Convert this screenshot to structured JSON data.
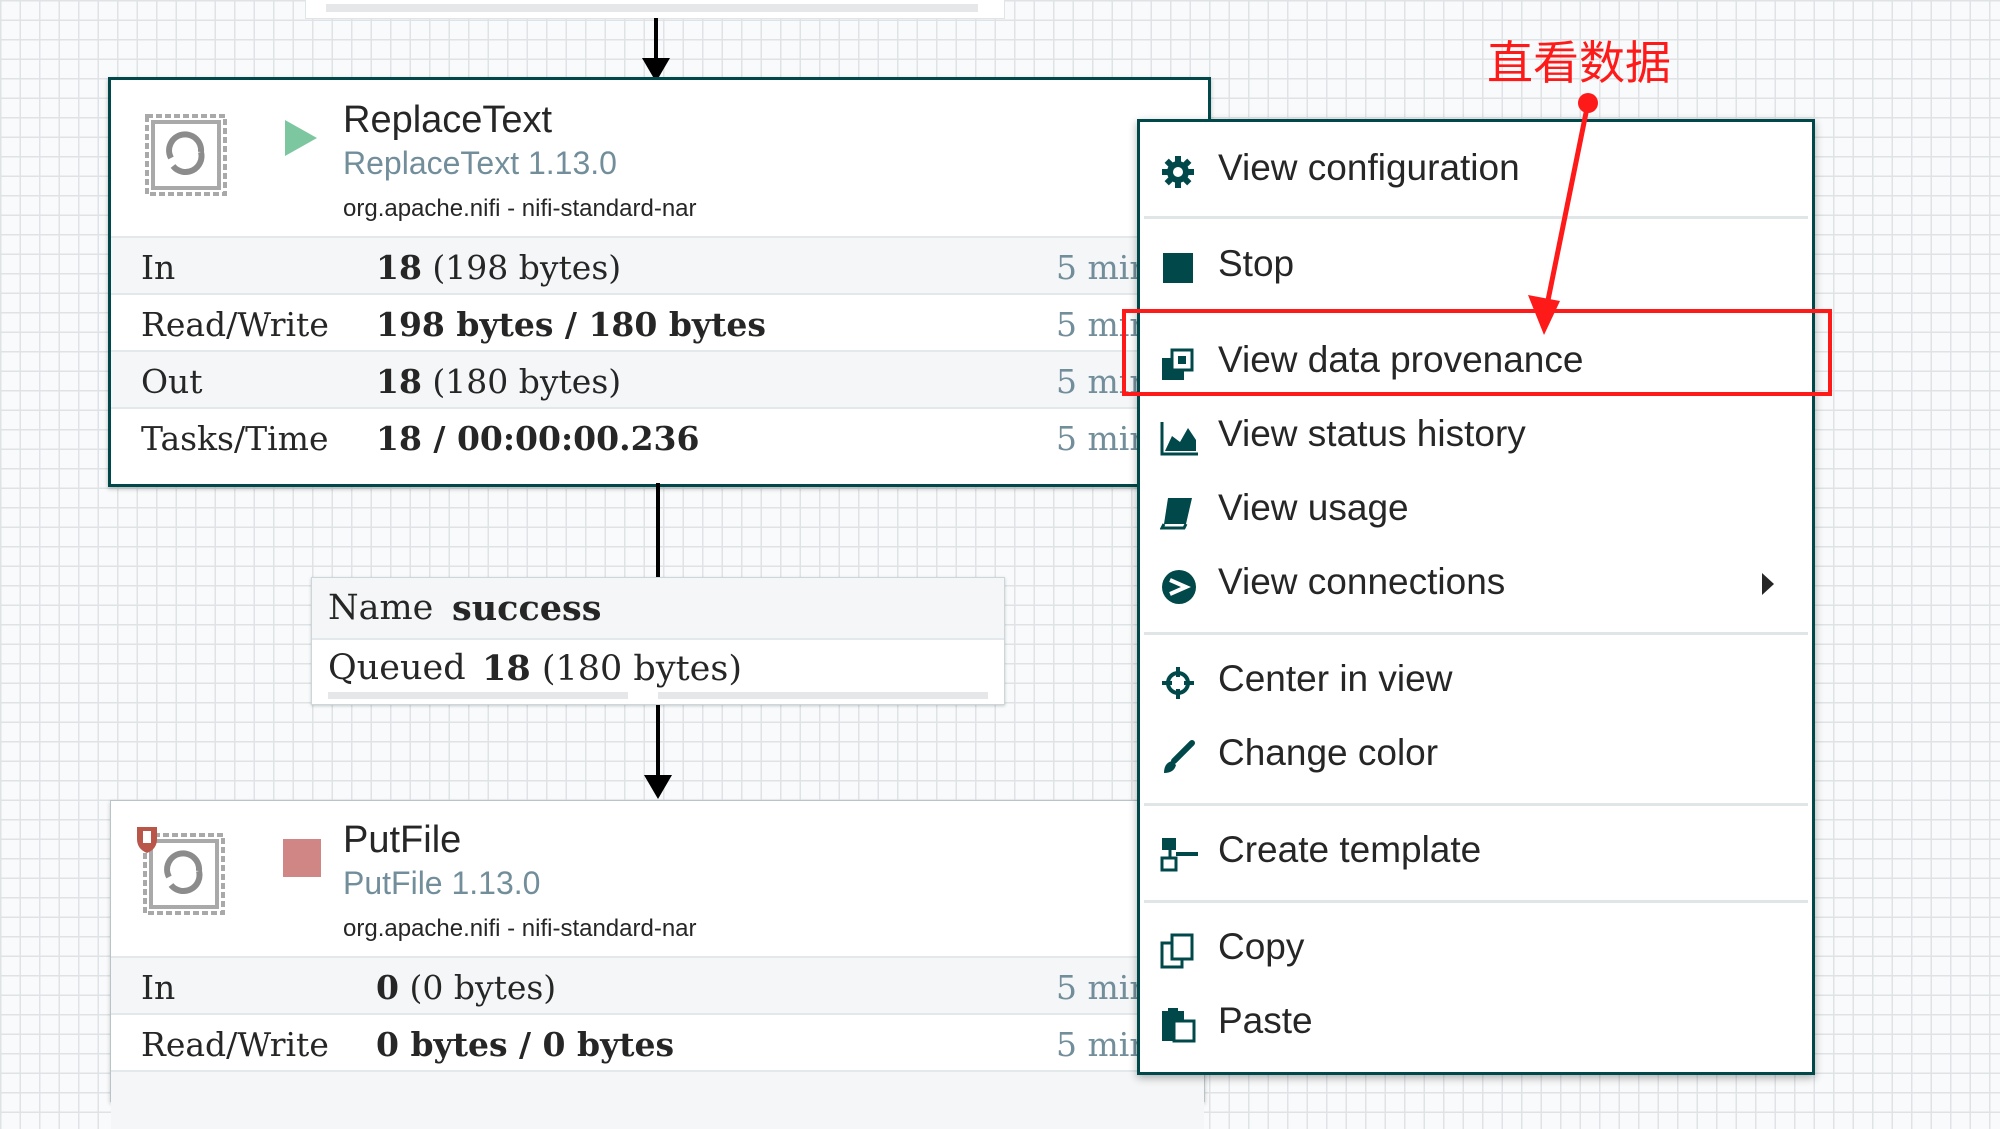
{
  "processors": [
    {
      "name": "ReplaceText",
      "version": "ReplaceText 1.13.0",
      "bundle": "org.apache.nifi - nifi-standard-nar",
      "state": "running",
      "stats": [
        {
          "label": "In",
          "bold": "18",
          "plain": " (198 bytes)",
          "time": "5 min"
        },
        {
          "label": "Read/Write",
          "bold": "198 bytes / 180 bytes",
          "plain": "",
          "time": "5 min"
        },
        {
          "label": "Out",
          "bold": "18",
          "plain": " (180 bytes)",
          "time": "5 min"
        },
        {
          "label": "Tasks/Time",
          "bold": "18 / 00:00:00.236",
          "plain": "",
          "time": "5 min"
        }
      ]
    },
    {
      "name": "PutFile",
      "version": "PutFile 1.13.0",
      "bundle": "org.apache.nifi - nifi-standard-nar",
      "state": "stopped",
      "stats": [
        {
          "label": "In",
          "bold": "0",
          "plain": " (0 bytes)",
          "time": "5 min"
        },
        {
          "label": "Read/Write",
          "bold": "0 bytes / 0 bytes",
          "plain": "",
          "time": "5 min"
        }
      ]
    }
  ],
  "connection": {
    "name_label": "Name",
    "name_value": "success",
    "queued_label": "Queued",
    "queued_count": "18",
    "queued_bytes": " (180 bytes)"
  },
  "context_menu": {
    "items": [
      {
        "label": "View configuration",
        "icon": "gear-icon"
      },
      {
        "label": "Stop",
        "icon": "stop-icon"
      },
      {
        "label": "View data provenance",
        "icon": "provenance-icon"
      },
      {
        "label": "View status history",
        "icon": "area-chart-icon"
      },
      {
        "label": "View usage",
        "icon": "book-icon"
      },
      {
        "label": "View connections",
        "icon": "connections-icon",
        "submenu": true
      },
      {
        "label": "Center in view",
        "icon": "crosshair-icon"
      },
      {
        "label": "Change color",
        "icon": "paintbrush-icon"
      },
      {
        "label": "Create template",
        "icon": "template-icon"
      },
      {
        "label": "Copy",
        "icon": "copy-icon"
      },
      {
        "label": "Paste",
        "icon": "paste-icon"
      }
    ]
  },
  "annotation": {
    "text": "直看数据",
    "color": "#ff1a1a"
  },
  "colors": {
    "accent_border": "#004849",
    "secondary_text": "#728e9b",
    "run_green": "#7dc7a0",
    "stop_red": "#d18686"
  }
}
